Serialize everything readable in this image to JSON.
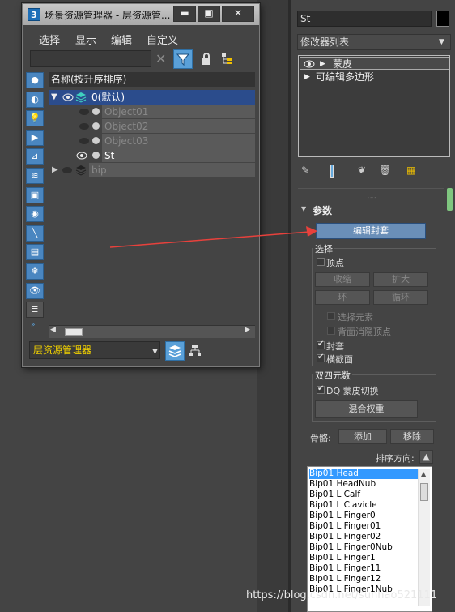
{
  "window": {
    "app_icon_text": "3",
    "title": "场景资源管理器 - 层资源管...",
    "menu": [
      "选择",
      "显示",
      "编辑",
      "自定义"
    ],
    "column_header": "名称(按升序排序)",
    "tree": [
      {
        "label": "0(默认)",
        "level": 0,
        "selected": true
      },
      {
        "label": "Object01",
        "level": 1,
        "hidden": true
      },
      {
        "label": "Object02",
        "level": 1,
        "hidden": true
      },
      {
        "label": "Object03",
        "level": 1,
        "hidden": true
      },
      {
        "label": "St",
        "level": 1,
        "hidden": false
      },
      {
        "label": "bip",
        "level": 0,
        "hidden": true
      }
    ],
    "bottom_combo": "层资源管理器",
    "accent_color": "#5aa0d8",
    "selection_color": "#2b4c8c"
  },
  "modifier_panel": {
    "object_name": "St",
    "modifier_list": "修改器列表",
    "stack": [
      "蒙皮",
      "可编辑多边形"
    ],
    "rollout_title": "参数",
    "edit_envelope": "编辑封套",
    "select_group": {
      "title": "选择",
      "vertices": "顶点",
      "shrink": "收缩",
      "grow": "扩大",
      "ring": "环",
      "loop": "循环",
      "select_element": "选择元素",
      "backface_cull": "背面消隐顶点",
      "envelopes": "封套",
      "cross_sections": "横截面"
    },
    "dq_group": {
      "title": "双四元数",
      "dq_toggle": "DQ 蒙皮切换",
      "blend_weights": "混合权重"
    },
    "bones_label": "骨骼:",
    "add": "添加",
    "remove": "移除",
    "sort_label": "排序方向:",
    "bones": [
      "Bip01 Head",
      "Bip01 HeadNub",
      "Bip01 L Calf",
      "Bip01 L Clavicle",
      "Bip01 L Finger0",
      "Bip01 L Finger01",
      "Bip01 L Finger02",
      "Bip01 L Finger0Nub",
      "Bip01 L Finger1",
      "Bip01 L Finger11",
      "Bip01 L Finger12",
      "Bip01 L Finger1Nub"
    ]
  },
  "watermark": "https://blog.csdn.net/sunhao521111"
}
